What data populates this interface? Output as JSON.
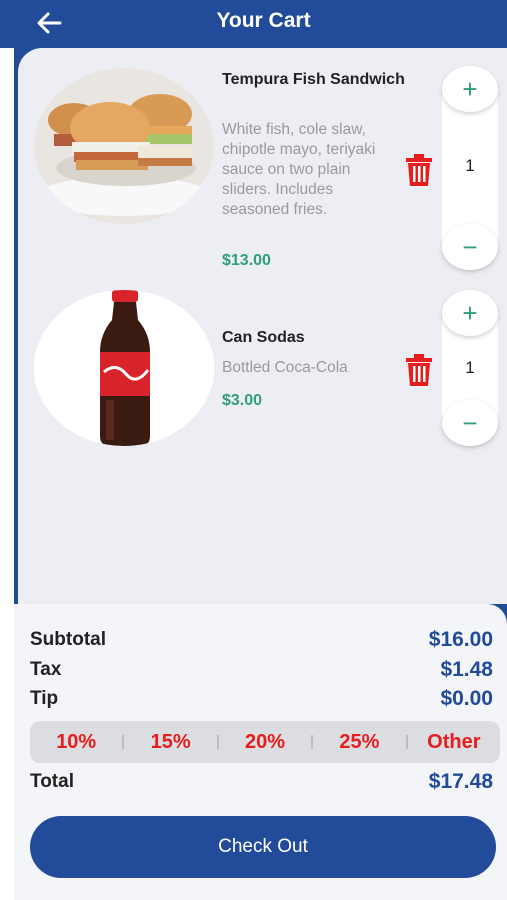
{
  "header": {
    "title": "Your Cart"
  },
  "items": [
    {
      "name": "Tempura Fish Sandwich",
      "description": "White fish, cole slaw, chipotle mayo, teriyaki sauce on two plain sliders.  Includes seasoned fries.",
      "price": "$13.00",
      "quantity": "1"
    },
    {
      "name": "Can Sodas",
      "description": "Bottled Coca-Cola",
      "price": "$3.00",
      "quantity": "1"
    }
  ],
  "summary": {
    "subtotal_label": "Subtotal",
    "subtotal_value": "$16.00",
    "tax_label": "Tax",
    "tax_value": "$1.48",
    "tip_label": "Tip",
    "tip_value": "$0.00",
    "tip_options": [
      "10%",
      "15%",
      "20%",
      "25%",
      "Other"
    ],
    "total_label": "Total",
    "total_value": "$17.48"
  },
  "checkout_label": "Check Out",
  "colors": {
    "brand": "#224b9a",
    "price": "#2e9e7c",
    "delete": "#e51d1d"
  }
}
